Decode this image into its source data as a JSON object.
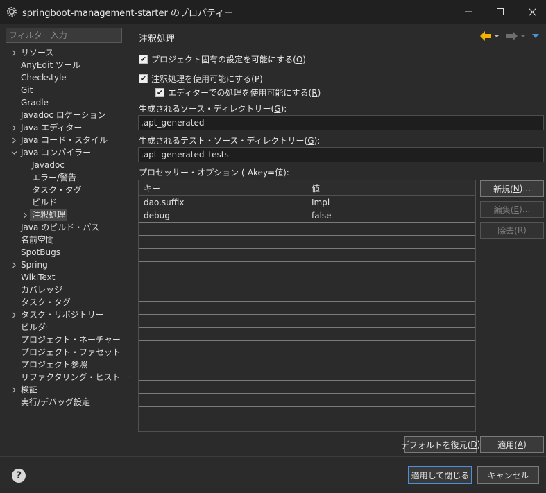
{
  "window": {
    "title": "springboot-management-starter のプロパティー",
    "icons": [
      "gear-icon",
      "minimize-icon",
      "maximize-icon",
      "close-icon"
    ]
  },
  "sidebar": {
    "filter_placeholder": "フィルター入力",
    "items": [
      {
        "label": "リソース",
        "expandable": true,
        "expanded": false,
        "level": 0
      },
      {
        "label": "AnyEdit ツール",
        "expandable": false,
        "level": 0
      },
      {
        "label": "Checkstyle",
        "expandable": false,
        "level": 0
      },
      {
        "label": "Git",
        "expandable": false,
        "level": 0
      },
      {
        "label": "Gradle",
        "expandable": false,
        "level": 0
      },
      {
        "label": "Javadoc ロケーション",
        "expandable": false,
        "level": 0
      },
      {
        "label": "Java エディター",
        "expandable": true,
        "expanded": false,
        "level": 0
      },
      {
        "label": "Java コード・スタイル",
        "expandable": true,
        "expanded": false,
        "level": 0
      },
      {
        "label": "Java コンパイラー",
        "expandable": true,
        "expanded": true,
        "level": 0
      },
      {
        "label": "Javadoc",
        "expandable": false,
        "level": 1
      },
      {
        "label": "エラー/警告",
        "expandable": false,
        "level": 1
      },
      {
        "label": "タスク・タグ",
        "expandable": false,
        "level": 1
      },
      {
        "label": "ビルド",
        "expandable": false,
        "level": 1
      },
      {
        "label": "注釈処理",
        "expandable": true,
        "expanded": false,
        "level": 1,
        "selected": true
      },
      {
        "label": "Java のビルド・パス",
        "expandable": false,
        "level": 0
      },
      {
        "label": "名前空間",
        "expandable": false,
        "level": 0
      },
      {
        "label": "SpotBugs",
        "expandable": false,
        "level": 0
      },
      {
        "label": "Spring",
        "expandable": true,
        "expanded": false,
        "level": 0
      },
      {
        "label": "WikiText",
        "expandable": false,
        "level": 0
      },
      {
        "label": "カバレッジ",
        "expandable": false,
        "level": 0
      },
      {
        "label": "タスク・タグ",
        "expandable": false,
        "level": 0
      },
      {
        "label": "タスク・リポジトリー",
        "expandable": true,
        "expanded": false,
        "level": 0
      },
      {
        "label": "ビルダー",
        "expandable": false,
        "level": 0
      },
      {
        "label": "プロジェクト・ネーチャー",
        "expandable": false,
        "level": 0
      },
      {
        "label": "プロジェクト・ファセット",
        "expandable": false,
        "level": 0
      },
      {
        "label": "プロジェクト参照",
        "expandable": false,
        "level": 0
      },
      {
        "label": "リファクタリング・ヒストリー",
        "expandable": false,
        "level": 0
      },
      {
        "label": "検証",
        "expandable": true,
        "expanded": false,
        "level": 0
      },
      {
        "label": "実行/デバッグ設定",
        "expandable": false,
        "level": 0
      }
    ]
  },
  "page": {
    "title": "注釈処理",
    "nav": {
      "back_color": "#f0b400",
      "dropdown_color": "#4d8fd9"
    },
    "project_specific": {
      "label": "プロジェクト固有の設定を可能にする(",
      "mnemonic": "O",
      "suffix": ")",
      "checked": true
    },
    "enable_annotation": {
      "label": "注釈処理を使用可能にする(",
      "mnemonic": "P",
      "suffix": ")",
      "checked": true
    },
    "enable_editor": {
      "label": "エディターでの処理を使用可能にする(",
      "mnemonic": "R",
      "suffix": ")",
      "checked": true
    },
    "source_dir": {
      "label": "生成されるソース・ディレクトリー(",
      "mnemonic": "G",
      "suffix": "):",
      "value": ".apt_generated"
    },
    "test_source_dir": {
      "label": "生成されるテスト・ソース・ディレクトリー(",
      "mnemonic": "G",
      "suffix": "):",
      "value": ".apt_generated_tests"
    },
    "processor_options_label": "プロセッサー・オプション (-Akey=値):",
    "table": {
      "columns": [
        "キー",
        "値"
      ],
      "rows": [
        {
          "key": "dao.suffix",
          "value": "Impl"
        },
        {
          "key": "debug",
          "value": "false"
        }
      ],
      "empty_rows": 15
    },
    "buttons": {
      "new": {
        "label": "新規(",
        "mnemonic": "N",
        "suffix": ")..."
      },
      "edit": {
        "label": "編集(",
        "mnemonic": "E",
        "suffix": ")..."
      },
      "remove": {
        "label": "除去(",
        "mnemonic": "R",
        "suffix": ")"
      },
      "restore_defaults": {
        "label": "デフォルトを復元(",
        "mnemonic": "D",
        "suffix": ")"
      },
      "apply": {
        "label": "適用(",
        "mnemonic": "A",
        "suffix": ")"
      }
    }
  },
  "footer": {
    "help_icon": "?",
    "apply_close_label": "適用して閉じる",
    "cancel_label": "キャンセル",
    "accent": "#4d8fd9"
  }
}
